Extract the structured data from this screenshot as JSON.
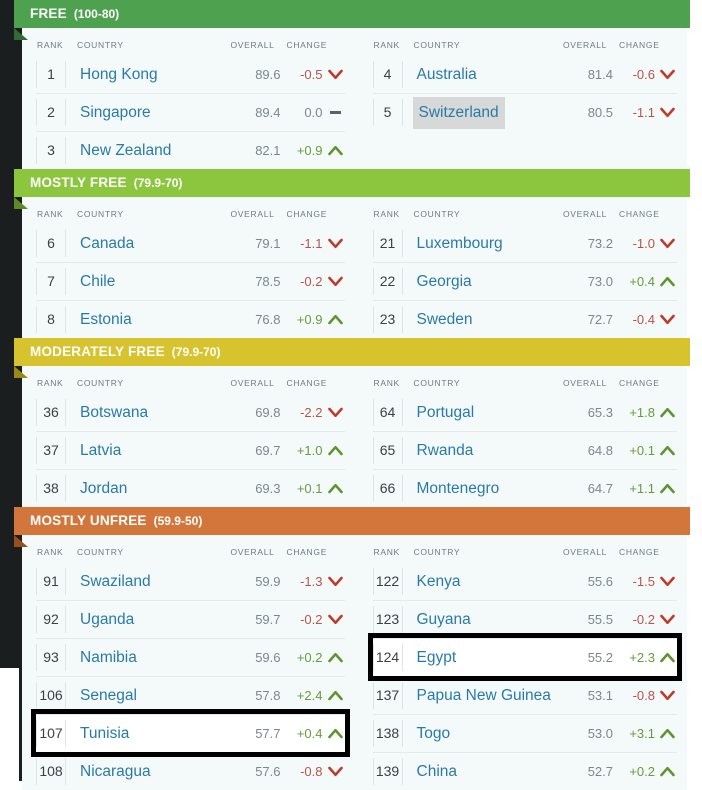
{
  "columns": {
    "rank": "RANK",
    "country": "COUNTRY",
    "overall": "OVERALL",
    "change": "CHANGE"
  },
  "colors": {
    "free": "#4ea24f",
    "mostly_free": "#8cc63e",
    "moderately_free": "#d7c32e",
    "mostly_unfree": "#d2763c",
    "country_link": "#2a7aa8",
    "up": "#6a9a3a",
    "down": "#b9534a",
    "flat": "#7d878b",
    "panel_bg": "#f4fafa",
    "rail": "#1a1e1e",
    "highlight_row": "#d7d9d8"
  },
  "sections": [
    {
      "title": "FREE",
      "range": "(100-80)",
      "color": "#4ea24f",
      "fold_color": "#2f6b33",
      "left": [
        {
          "rank": "1",
          "country": "Hong Kong",
          "overall": "89.6",
          "change": "-0.5",
          "dir": "down",
          "highlighted": false,
          "boxed": false
        },
        {
          "rank": "2",
          "country": "Singapore",
          "overall": "89.4",
          "change": "0.0",
          "dir": "flat",
          "highlighted": false,
          "boxed": false
        },
        {
          "rank": "3",
          "country": "New Zealand",
          "overall": "82.1",
          "change": "+0.9",
          "dir": "up",
          "highlighted": false,
          "boxed": false
        }
      ],
      "right": [
        {
          "rank": "4",
          "country": "Australia",
          "overall": "81.4",
          "change": "-0.6",
          "dir": "down",
          "highlighted": false,
          "boxed": false
        },
        {
          "rank": "5",
          "country": "Switzerland",
          "overall": "80.5",
          "change": "-1.1",
          "dir": "down",
          "highlighted": true,
          "boxed": false
        }
      ]
    },
    {
      "title": "MOSTLY FREE",
      "range": "(79.9-70)",
      "color": "#8cc63e",
      "fold_color": "#5d8a25",
      "left": [
        {
          "rank": "6",
          "country": "Canada",
          "overall": "79.1",
          "change": "-1.1",
          "dir": "down",
          "highlighted": false,
          "boxed": false
        },
        {
          "rank": "7",
          "country": "Chile",
          "overall": "78.5",
          "change": "-0.2",
          "dir": "down",
          "highlighted": false,
          "boxed": false
        },
        {
          "rank": "8",
          "country": "Estonia",
          "overall": "76.8",
          "change": "+0.9",
          "dir": "up",
          "highlighted": false,
          "boxed": false
        }
      ],
      "right": [
        {
          "rank": "21",
          "country": "Luxembourg",
          "overall": "73.2",
          "change": "-1.0",
          "dir": "down",
          "highlighted": false,
          "boxed": false
        },
        {
          "rank": "22",
          "country": "Georgia",
          "overall": "73.0",
          "change": "+0.4",
          "dir": "up",
          "highlighted": false,
          "boxed": false
        },
        {
          "rank": "23",
          "country": "Sweden",
          "overall": "72.7",
          "change": "-0.4",
          "dir": "down",
          "highlighted": false,
          "boxed": false
        }
      ]
    },
    {
      "title": "MODERATELY FREE",
      "range": "(79.9-70)",
      "color": "#d7c32e",
      "fold_color": "#9a8a15",
      "left": [
        {
          "rank": "36",
          "country": "Botswana",
          "overall": "69.8",
          "change": "-2.2",
          "dir": "down",
          "highlighted": false,
          "boxed": false
        },
        {
          "rank": "37",
          "country": "Latvia",
          "overall": "69.7",
          "change": "+1.0",
          "dir": "up",
          "highlighted": false,
          "boxed": false
        },
        {
          "rank": "38",
          "country": "Jordan",
          "overall": "69.3",
          "change": "+0.1",
          "dir": "up",
          "highlighted": false,
          "boxed": false
        }
      ],
      "right": [
        {
          "rank": "64",
          "country": "Portugal",
          "overall": "65.3",
          "change": "+1.8",
          "dir": "up",
          "highlighted": false,
          "boxed": false
        },
        {
          "rank": "65",
          "country": "Rwanda",
          "overall": "64.8",
          "change": "+0.1",
          "dir": "up",
          "highlighted": false,
          "boxed": false
        },
        {
          "rank": "66",
          "country": "Montenegro",
          "overall": "64.7",
          "change": "+1.1",
          "dir": "up",
          "highlighted": false,
          "boxed": false
        }
      ]
    },
    {
      "title": "MOSTLY UNFREE",
      "range": "(59.9-50)",
      "color": "#d2763c",
      "fold_color": "#96501f",
      "left": [
        {
          "rank": "91",
          "country": "Swaziland",
          "overall": "59.9",
          "change": "-1.3",
          "dir": "down",
          "highlighted": false,
          "boxed": false
        },
        {
          "rank": "92",
          "country": "Uganda",
          "overall": "59.7",
          "change": "-0.2",
          "dir": "down",
          "highlighted": false,
          "boxed": false
        },
        {
          "rank": "93",
          "country": "Namibia",
          "overall": "59.6",
          "change": "+0.2",
          "dir": "up",
          "highlighted": false,
          "boxed": false
        },
        {
          "rank": "106",
          "country": "Senegal",
          "overall": "57.8",
          "change": "+2.4",
          "dir": "up",
          "highlighted": false,
          "boxed": false
        },
        {
          "rank": "107",
          "country": "Tunisia",
          "overall": "57.7",
          "change": "+0.4",
          "dir": "up",
          "highlighted": false,
          "boxed": true
        },
        {
          "rank": "108",
          "country": "Nicaragua",
          "overall": "57.6",
          "change": "-0.8",
          "dir": "down",
          "highlighted": false,
          "boxed": false
        }
      ],
      "right": [
        {
          "rank": "122",
          "country": "Kenya",
          "overall": "55.6",
          "change": "-1.5",
          "dir": "down",
          "highlighted": false,
          "boxed": false
        },
        {
          "rank": "123",
          "country": "Guyana",
          "overall": "55.5",
          "change": "-0.2",
          "dir": "down",
          "highlighted": false,
          "boxed": false
        },
        {
          "rank": "124",
          "country": "Egypt",
          "overall": "55.2",
          "change": "+2.3",
          "dir": "up",
          "highlighted": false,
          "boxed": true
        },
        {
          "rank": "137",
          "country": "Papua New Guinea",
          "overall": "53.1",
          "change": "-0.8",
          "dir": "down",
          "highlighted": false,
          "boxed": false
        },
        {
          "rank": "138",
          "country": "Togo",
          "overall": "53.0",
          "change": "+3.1",
          "dir": "up",
          "highlighted": false,
          "boxed": false
        },
        {
          "rank": "139",
          "country": "China",
          "overall": "52.7",
          "change": "+0.2",
          "dir": "up",
          "highlighted": false,
          "boxed": false
        }
      ]
    }
  ]
}
